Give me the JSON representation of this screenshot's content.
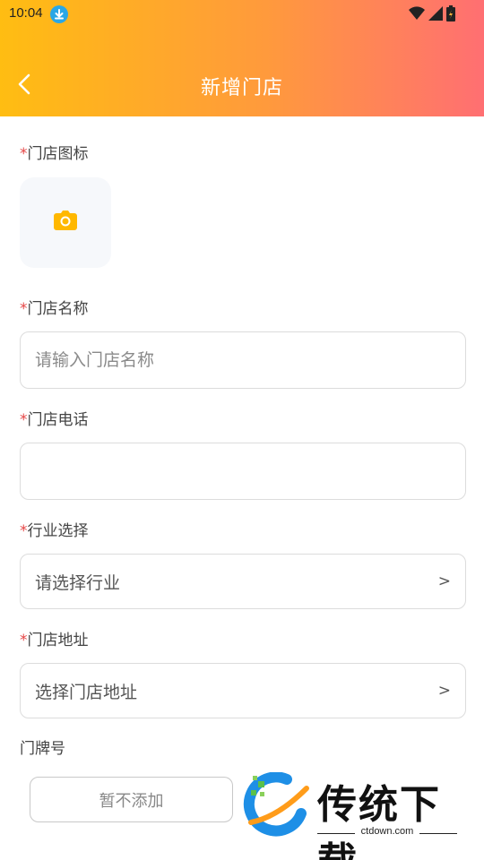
{
  "status_bar": {
    "time": "10:04"
  },
  "nav": {
    "title": "新增门店"
  },
  "form": {
    "required_mark": "*",
    "icon_label": "门店图标",
    "name_label": "门店名称",
    "name_placeholder": "请输入门店名称",
    "phone_label": "门店电话",
    "industry_label": "行业选择",
    "industry_placeholder": "请选择行业",
    "address_label": "门店地址",
    "address_placeholder": "选择门店地址",
    "house_number_label": "门牌号",
    "chevron": ">"
  },
  "actions": {
    "skip_label": "暂不添加"
  },
  "watermark": {
    "title": "传统下载",
    "domain": "ctdown.com"
  },
  "colors": {
    "header_start": "#ffbd12",
    "header_end": "#ff6f72",
    "accent": "#ffb800",
    "required": "#e54545"
  }
}
